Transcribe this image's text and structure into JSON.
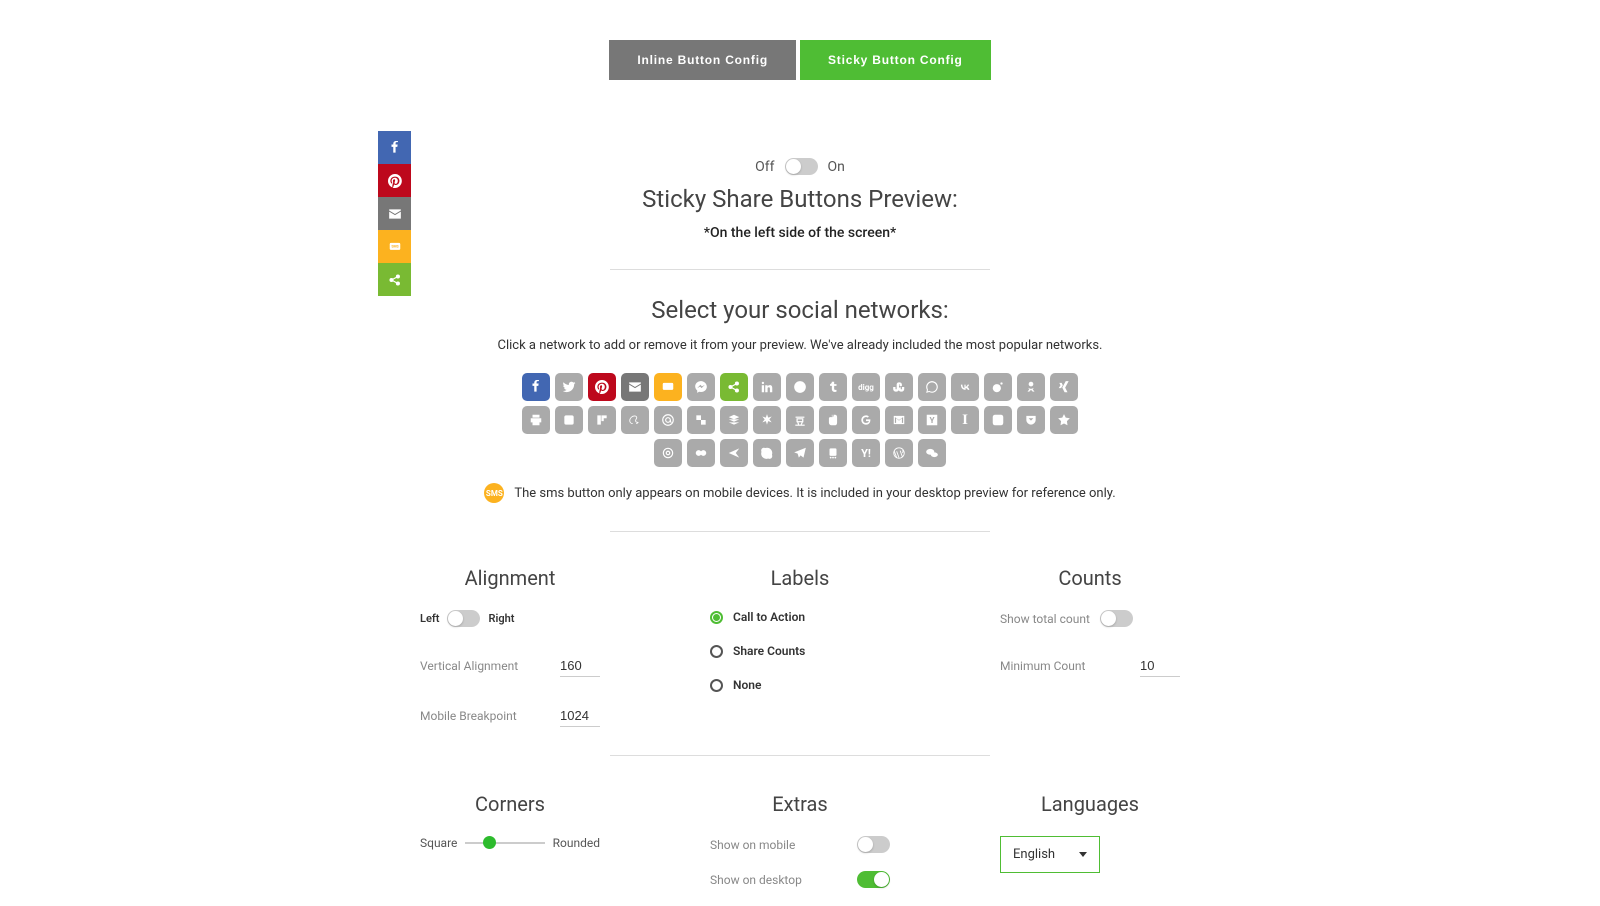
{
  "tabs": {
    "inline": "Inline Button Config",
    "sticky": "Sticky Button Config"
  },
  "toggle": {
    "off": "Off",
    "on": "On"
  },
  "preview": {
    "title": "Sticky Share Buttons Preview:",
    "sub": "*On the left side of the screen*"
  },
  "select": {
    "title": "Select your social networks:",
    "sub": "Click a network to add or remove it from your preview. We've already included the most popular networks."
  },
  "sms_note": "The sms button only appears on mobile devices. It is included in your desktop preview for reference only.",
  "alignment": {
    "heading": "Alignment",
    "left": "Left",
    "right": "Right",
    "va_label": "Vertical Alignment",
    "va_value": "160",
    "mb_label": "Mobile Breakpoint",
    "mb_value": "1024"
  },
  "labels": {
    "heading": "Labels",
    "cta": "Call to Action",
    "counts": "Share Counts",
    "none": "None"
  },
  "counts": {
    "heading": "Counts",
    "show_label": "Show total count",
    "min_label": "Minimum Count",
    "min_value": "10"
  },
  "corners": {
    "heading": "Corners",
    "square": "Square",
    "rounded": "Rounded"
  },
  "extras": {
    "heading": "Extras",
    "mobile": "Show on mobile",
    "desktop": "Show on desktop"
  },
  "languages": {
    "heading": "Languages",
    "selected": "English"
  }
}
